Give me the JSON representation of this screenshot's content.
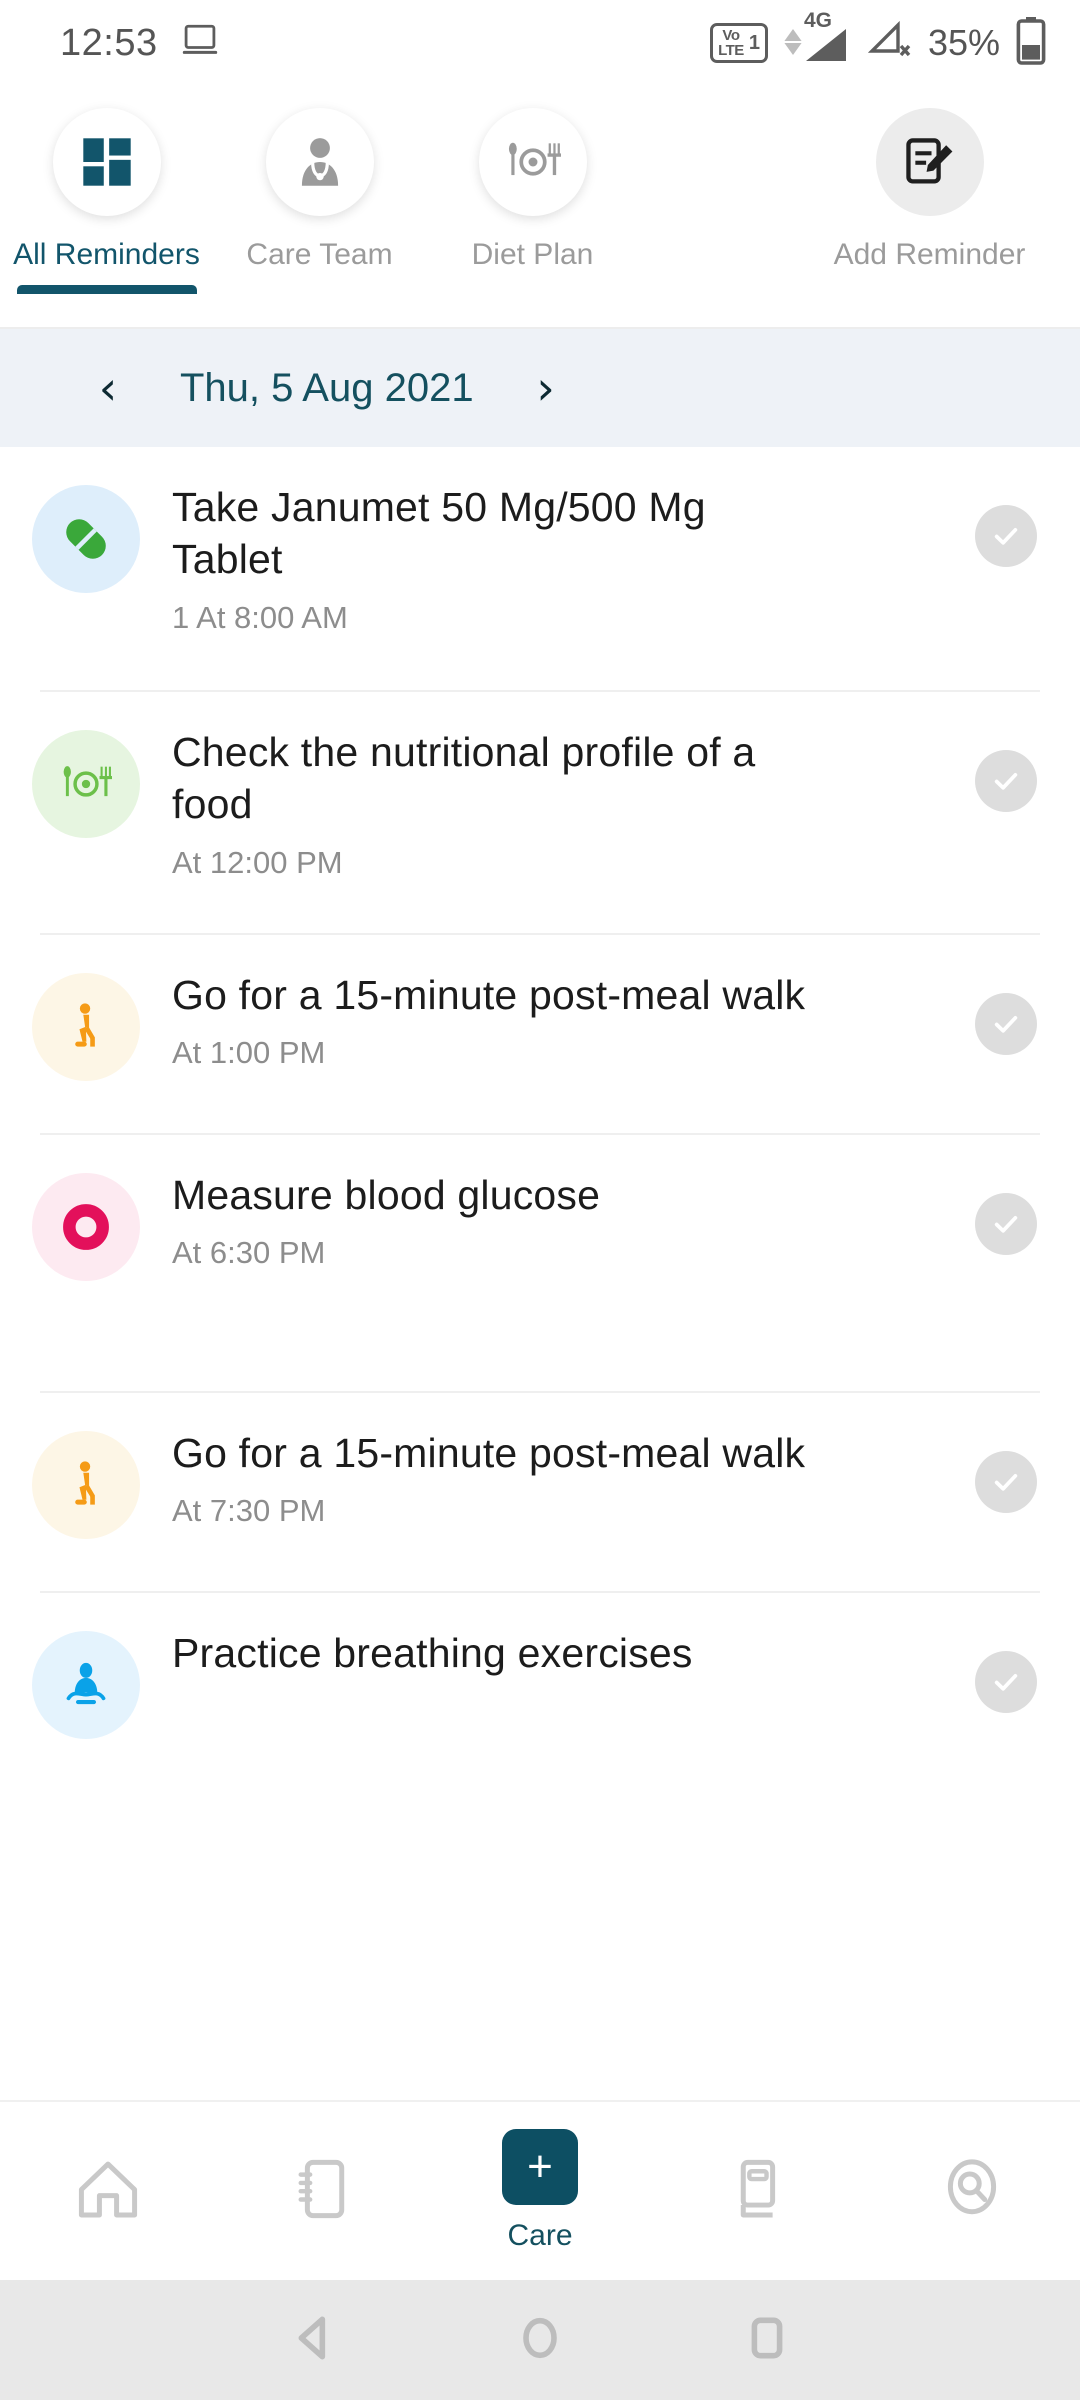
{
  "status_bar": {
    "time": "12:53",
    "cast_icon": "laptop-icon",
    "volte_top": "Vo",
    "volte_bottom": "LTE",
    "sim_index": "1",
    "network": "4G",
    "battery_percent": "35%"
  },
  "top_tabs": [
    {
      "label": "All Reminders",
      "icon": "grid-dashboard-icon",
      "active": true
    },
    {
      "label": "Care Team",
      "icon": "doctor-person-icon",
      "active": false
    },
    {
      "label": "Diet Plan",
      "icon": "plate-cutlery-icon",
      "active": false
    },
    {
      "label": "Add Reminder",
      "icon": "note-pencil-icon",
      "active": false
    }
  ],
  "date_bar": {
    "prev_icon": "chevron-left-icon",
    "date": "Thu, 5 Aug 2021",
    "next_icon": "chevron-right-icon"
  },
  "reminders": [
    {
      "title": "Take Janumet 50 Mg/500 Mg Tablet",
      "subtitle": "1 At 8:00 AM",
      "icon": "pill-capsule-icon",
      "icon_color": "#3aa83a",
      "icon_bg": "#deeefb",
      "check_icon": "check-circle-icon"
    },
    {
      "title": "Check the nutritional profile of a food",
      "subtitle": "At 12:00 PM",
      "icon": "plate-cutlery-icon",
      "icon_color": "#6cc04a",
      "icon_bg": "#e6f5e0",
      "check_icon": "check-circle-icon"
    },
    {
      "title": "Go for a 15-minute post-meal walk",
      "subtitle": "At 1:00 PM",
      "icon": "walking-person-icon",
      "icon_color": "#f59b16",
      "icon_bg": "#fdf6e6",
      "check_icon": "check-circle-icon"
    },
    {
      "title": "Measure blood glucose",
      "subtitle": "At 6:30 PM",
      "icon": "blood-drop-icon",
      "icon_color": "#e3105b",
      "icon_bg": "#fdeaf1",
      "check_icon": "check-circle-icon"
    },
    {
      "title": "Go for a 15-minute post-meal walk",
      "subtitle": "At 7:30 PM",
      "icon": "walking-person-icon",
      "icon_color": "#f59b16",
      "icon_bg": "#fdf6e6",
      "check_icon": "check-circle-icon"
    },
    {
      "title": "Practice breathing exercises",
      "subtitle": "",
      "icon": "meditation-person-icon",
      "icon_color": "#0aa2e8",
      "icon_bg": "#e4f3fd",
      "check_icon": "check-circle-icon"
    }
  ],
  "bottom_nav": {
    "items": [
      {
        "label": "",
        "icon": "home-icon",
        "active": false
      },
      {
        "label": "",
        "icon": "notebook-icon",
        "active": false
      },
      {
        "label": "Care",
        "icon": "plus-icon",
        "active": true
      },
      {
        "label": "",
        "icon": "reader-book-icon",
        "active": false
      },
      {
        "label": "",
        "icon": "search-icon",
        "active": false
      }
    ]
  },
  "system_nav": {
    "back": "back-triangle-icon",
    "home": "home-circle-icon",
    "recents": "recents-square-icon"
  },
  "colors": {
    "accent": "#12556b",
    "date_bar_bg": "#eef2f7",
    "check_gray": "#dddddd"
  }
}
